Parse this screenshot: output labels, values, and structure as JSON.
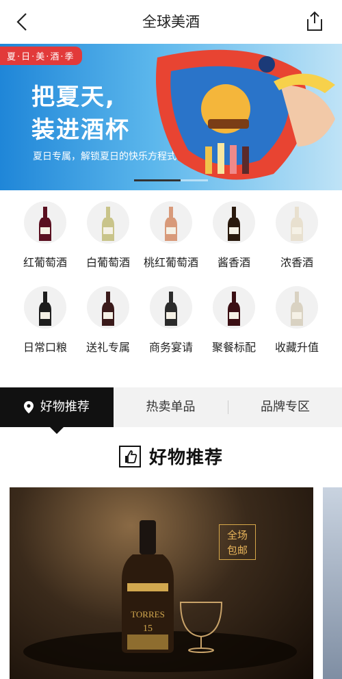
{
  "header": {
    "title": "全球美酒",
    "back_icon": "chevron-left-icon",
    "share_icon": "share-icon"
  },
  "banner": {
    "tag": "夏·日·美·酒·季",
    "headline_line1": "把夏天,",
    "headline_line2": "装进酒杯",
    "subtitle": "夏日专属，解锁夏日的快乐方程式",
    "active_slide_fraction": 0.63
  },
  "categories": [
    {
      "label": "红葡萄酒",
      "bottle_color": "#5a1020"
    },
    {
      "label": "白葡萄酒",
      "bottle_color": "#c9c48a"
    },
    {
      "label": "桃红葡萄酒",
      "bottle_color": "#d89a7a"
    },
    {
      "label": "酱香酒",
      "bottle_color": "#2a1a0e"
    },
    {
      "label": "浓香酒",
      "bottle_color": "#e8e0cf"
    },
    {
      "label": "日常口粮",
      "bottle_color": "#1e1e1e"
    },
    {
      "label": "送礼专属",
      "bottle_color": "#3a1a1a"
    },
    {
      "label": "商务宴请",
      "bottle_color": "#2b2b2b"
    },
    {
      "label": "聚餐标配",
      "bottle_color": "#3b0f14"
    },
    {
      "label": "收藏升值",
      "bottle_color": "#d9d2c2"
    }
  ],
  "tabs": [
    {
      "label": "好物推荐",
      "active": true
    },
    {
      "label": "热卖单品",
      "active": false
    },
    {
      "label": "品牌专区",
      "active": false
    }
  ],
  "section": {
    "title": "好物推荐",
    "icon": "thumbs-up-icon"
  },
  "product": {
    "badge_line1": "全场",
    "badge_line2": "包邮",
    "bottle_brand": "TORRES",
    "bottle_number": "15"
  }
}
